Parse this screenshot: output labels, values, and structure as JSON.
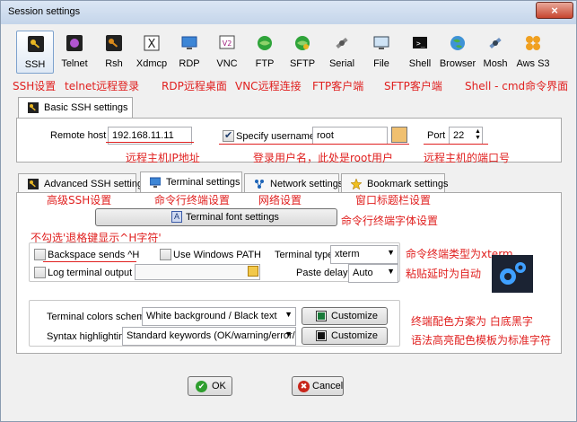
{
  "window": {
    "title": "Session settings",
    "close_glyph": "×"
  },
  "sessions": [
    {
      "label": "SSH",
      "icon": "key-icon",
      "active": true
    },
    {
      "label": "Telnet",
      "icon": "telnet-icon"
    },
    {
      "label": "Rsh",
      "icon": "rsh-key-icon"
    },
    {
      "label": "Xdmcp",
      "icon": "xdmcp-icon"
    },
    {
      "label": "RDP",
      "icon": "rdp-monitor-icon"
    },
    {
      "label": "VNC",
      "icon": "vnc-icon"
    },
    {
      "label": "FTP",
      "icon": "ftp-globe-icon"
    },
    {
      "label": "SFTP",
      "icon": "sftp-globe-icon"
    },
    {
      "label": "Serial",
      "icon": "serial-satellite-icon"
    },
    {
      "label": "File",
      "icon": "file-monitor-icon"
    },
    {
      "label": "Shell",
      "icon": "shell-terminal-icon"
    },
    {
      "label": "Browser",
      "icon": "browser-globe-icon"
    },
    {
      "label": "Mosh",
      "icon": "mosh-satellite-icon"
    },
    {
      "label": "Aws S3",
      "icon": "aws-s3-icon"
    }
  ],
  "annotations": {
    "ssh": "SSH设置",
    "telnet": "telnet远程登录",
    "rdp": "RDP远程桌面",
    "vnc": "VNC远程连接",
    "ftp": "FTP客户端",
    "sftp": "SFTP客户端",
    "shell": "Shell - cmd命令界面",
    "remote_host": "远程主机IP地址",
    "username": "登录用户名，此处是root用户",
    "port": "远程主机的端口号",
    "advanced": "高级SSH设置",
    "terminal": "命令行终端设置",
    "network": "网络设置",
    "bookmark": "窗口标题栏设置",
    "font": "命令行终端字体设置",
    "backspace": "不勾选'退格键显示^H字符'",
    "terminal_type": "命令终端类型为xterm",
    "paste_delay": "粘贴延时为自动",
    "colors": "终端配色方案为  白底黑字",
    "syntax": "语法高亮配色模板为标准字符"
  },
  "basic": {
    "tab_label": "Basic SSH settings",
    "remote_host_label": "Remote host *",
    "remote_host_value": "192.168.11.11",
    "specify_username_label": "Specify username",
    "username_value": "root",
    "port_label": "Port",
    "port_value": "22"
  },
  "tabs": [
    {
      "label": "Advanced SSH settings",
      "icon": "advanced-key-icon"
    },
    {
      "label": "Terminal settings",
      "icon": "terminal-monitor-icon",
      "active": true
    },
    {
      "label": "Network settings",
      "icon": "network-icon"
    },
    {
      "label": "Bookmark settings",
      "icon": "bookmark-star-icon"
    }
  ],
  "terminal": {
    "font_button": "Terminal font settings",
    "backspace_label": "Backspace sends ^H",
    "windows_path_label": "Use Windows PATH",
    "terminal_type_label": "Terminal type:",
    "terminal_type_value": "xterm",
    "log_output_label": "Log terminal output to:",
    "paste_delay_label": "Paste delay:",
    "paste_delay_value": "Auto",
    "colors_label": "Terminal colors scheme:",
    "colors_value": "White background / Black text",
    "syntax_label": "Syntax highlighting:",
    "syntax_value": "Standard keywords (OK/warning/error/...)",
    "customize_label": "Customize"
  },
  "footer": {
    "ok_label": "OK",
    "cancel_label": "Cancel"
  },
  "colors": {
    "accent_red": "#e0201f",
    "ok_green": "#2e9e2e",
    "cancel_red": "#c8261b",
    "gear_bg": "#1d4f9c"
  }
}
